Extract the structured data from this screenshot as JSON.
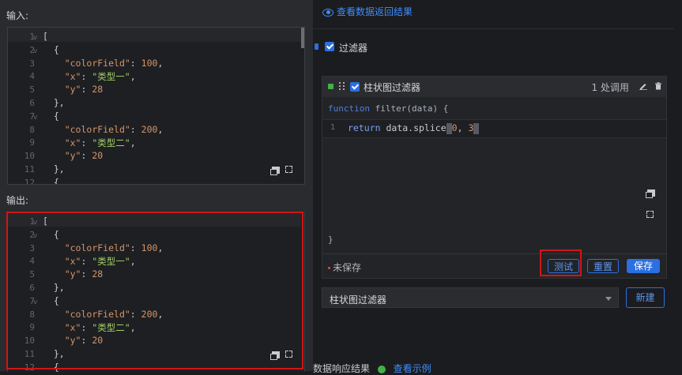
{
  "input_section": {
    "label": "输入:",
    "lines": [
      {
        "n": "1",
        "fold": true,
        "html": [
          {
            "t": "[",
            "c": "p"
          }
        ]
      },
      {
        "n": "2",
        "fold": true,
        "html": [
          {
            "t": "  {",
            "c": "p"
          }
        ]
      },
      {
        "n": "3",
        "fold": false,
        "html": [
          {
            "t": "    ",
            "c": "p"
          },
          {
            "t": "\"colorField\"",
            "c": "k"
          },
          {
            "t": ": ",
            "c": "p"
          },
          {
            "t": "100",
            "c": "n"
          },
          {
            "t": ",",
            "c": "p"
          }
        ]
      },
      {
        "n": "4",
        "fold": false,
        "html": [
          {
            "t": "    ",
            "c": "p"
          },
          {
            "t": "\"x\"",
            "c": "k"
          },
          {
            "t": ": ",
            "c": "p"
          },
          {
            "t": "\"类型一\"",
            "c": "s"
          },
          {
            "t": ",",
            "c": "p"
          }
        ]
      },
      {
        "n": "5",
        "fold": false,
        "html": [
          {
            "t": "    ",
            "c": "p"
          },
          {
            "t": "\"y\"",
            "c": "k"
          },
          {
            "t": ": ",
            "c": "p"
          },
          {
            "t": "28",
            "c": "n"
          }
        ]
      },
      {
        "n": "6",
        "fold": false,
        "html": [
          {
            "t": "  },",
            "c": "p"
          }
        ]
      },
      {
        "n": "7",
        "fold": true,
        "html": [
          {
            "t": "  {",
            "c": "p"
          }
        ]
      },
      {
        "n": "8",
        "fold": false,
        "html": [
          {
            "t": "    ",
            "c": "p"
          },
          {
            "t": "\"colorField\"",
            "c": "k"
          },
          {
            "t": ": ",
            "c": "p"
          },
          {
            "t": "200",
            "c": "n"
          },
          {
            "t": ",",
            "c": "p"
          }
        ]
      },
      {
        "n": "9",
        "fold": false,
        "html": [
          {
            "t": "    ",
            "c": "p"
          },
          {
            "t": "\"x\"",
            "c": "k"
          },
          {
            "t": ": ",
            "c": "p"
          },
          {
            "t": "\"类型二\"",
            "c": "s"
          },
          {
            "t": ",",
            "c": "p"
          }
        ]
      },
      {
        "n": "10",
        "fold": false,
        "html": [
          {
            "t": "    ",
            "c": "p"
          },
          {
            "t": "\"y\"",
            "c": "k"
          },
          {
            "t": ": ",
            "c": "p"
          },
          {
            "t": "20",
            "c": "n"
          }
        ]
      },
      {
        "n": "11",
        "fold": false,
        "html": [
          {
            "t": "  },",
            "c": "p"
          }
        ]
      },
      {
        "n": "12",
        "fold": false,
        "html": [
          {
            "t": "  {",
            "c": "p"
          }
        ]
      }
    ]
  },
  "output_section": {
    "label": "输出:",
    "lines": [
      {
        "n": "1",
        "fold": true,
        "html": [
          {
            "t": "[",
            "c": "p"
          }
        ]
      },
      {
        "n": "2",
        "fold": true,
        "html": [
          {
            "t": "  {",
            "c": "p"
          }
        ]
      },
      {
        "n": "3",
        "fold": false,
        "html": [
          {
            "t": "    ",
            "c": "p"
          },
          {
            "t": "\"colorField\"",
            "c": "k"
          },
          {
            "t": ": ",
            "c": "p"
          },
          {
            "t": "100",
            "c": "n"
          },
          {
            "t": ",",
            "c": "p"
          }
        ]
      },
      {
        "n": "4",
        "fold": false,
        "html": [
          {
            "t": "    ",
            "c": "p"
          },
          {
            "t": "\"x\"",
            "c": "k"
          },
          {
            "t": ": ",
            "c": "p"
          },
          {
            "t": "\"类型一\"",
            "c": "s"
          },
          {
            "t": ",",
            "c": "p"
          }
        ]
      },
      {
        "n": "5",
        "fold": false,
        "html": [
          {
            "t": "    ",
            "c": "p"
          },
          {
            "t": "\"y\"",
            "c": "k"
          },
          {
            "t": ": ",
            "c": "p"
          },
          {
            "t": "28",
            "c": "n"
          }
        ]
      },
      {
        "n": "6",
        "fold": false,
        "html": [
          {
            "t": "  },",
            "c": "p"
          }
        ]
      },
      {
        "n": "7",
        "fold": true,
        "html": [
          {
            "t": "  {",
            "c": "p"
          }
        ]
      },
      {
        "n": "8",
        "fold": false,
        "html": [
          {
            "t": "    ",
            "c": "p"
          },
          {
            "t": "\"colorField\"",
            "c": "k"
          },
          {
            "t": ": ",
            "c": "p"
          },
          {
            "t": "200",
            "c": "n"
          },
          {
            "t": ",",
            "c": "p"
          }
        ]
      },
      {
        "n": "9",
        "fold": false,
        "html": [
          {
            "t": "    ",
            "c": "p"
          },
          {
            "t": "\"x\"",
            "c": "k"
          },
          {
            "t": ": ",
            "c": "p"
          },
          {
            "t": "\"类型二\"",
            "c": "s"
          },
          {
            "t": ",",
            "c": "p"
          }
        ]
      },
      {
        "n": "10",
        "fold": false,
        "html": [
          {
            "t": "    ",
            "c": "p"
          },
          {
            "t": "\"y\"",
            "c": "k"
          },
          {
            "t": ": ",
            "c": "p"
          },
          {
            "t": "20",
            "c": "n"
          }
        ]
      },
      {
        "n": "11",
        "fold": false,
        "html": [
          {
            "t": "  },",
            "c": "p"
          }
        ]
      },
      {
        "n": "12",
        "fold": false,
        "html": [
          {
            "t": "  {",
            "c": "p"
          }
        ]
      }
    ]
  },
  "right": {
    "view_result_link": "查看数据返回结果",
    "filter_toggle_label": "过滤器",
    "filter_card": {
      "title": "柱状图过滤器",
      "call_count": "1 处调用",
      "fn_keyword": "function",
      "fn_signature": " filter(data) {",
      "code_line_number": "1",
      "code_keyword": "return",
      "code_expr_before": " data.splice",
      "code_arg1": "0",
      "code_sep": ", ",
      "code_arg2": "3",
      "closing_brace": "}",
      "status": "未保存",
      "test_button": "测试",
      "reset_button": "重置",
      "save_button": "保存"
    },
    "select_value": "柱状图过滤器",
    "new_button": "新建",
    "bottom_text": "数据响应结果",
    "bottom_link": "查看示例"
  },
  "colors": {
    "accent_blue": "#2b6fe0",
    "highlight_red": "#d01616",
    "status_green": "#43b048"
  }
}
